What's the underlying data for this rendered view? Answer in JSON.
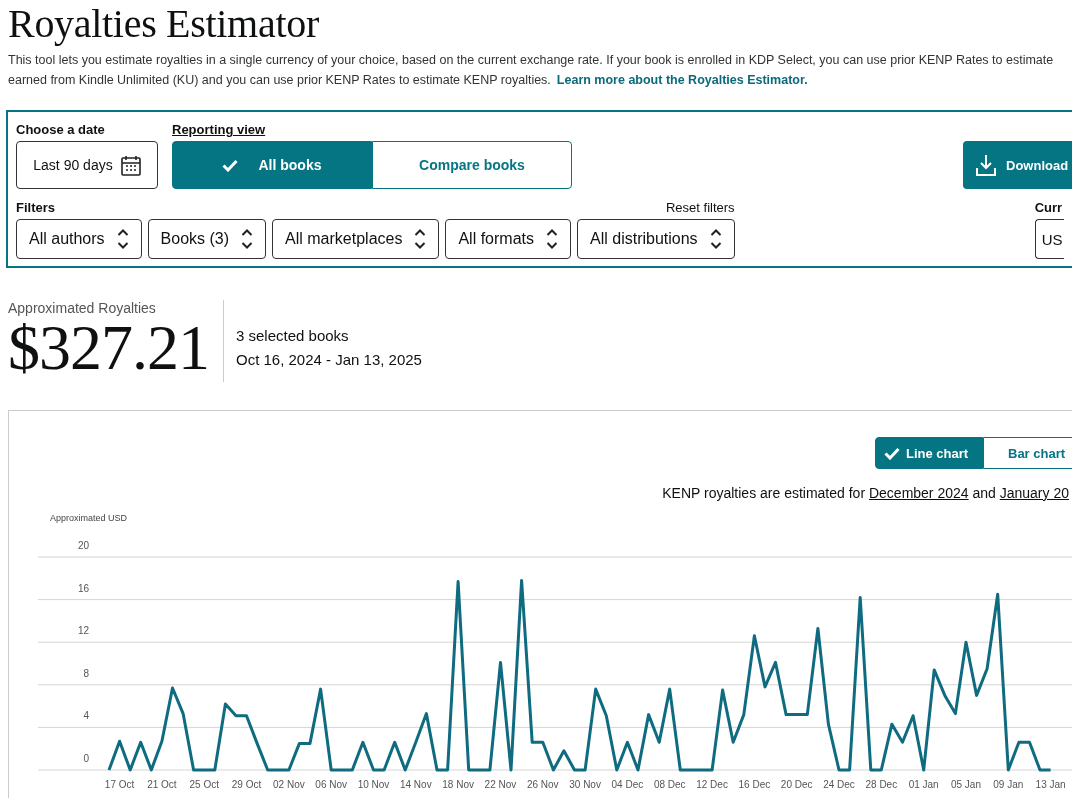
{
  "title": "Royalties Estimator",
  "description": {
    "line_1": "This tool lets you estimate royalties in a single currency of your choice, based on the current exchange rate. If your book is enrolled in KDP Select, you can use prior KENP Rates to estimate",
    "line_2": "earned from Kindle Unlimited (KU) and you can use prior KENP Rates to estimate KENP royalties.",
    "link": "Learn more about the Royalties Estimator."
  },
  "date_picker": {
    "label": "Choose a date",
    "value": "Last 90 days"
  },
  "reporting_view": {
    "label": "Reporting view",
    "options": [
      {
        "label": "All books",
        "selected": true
      },
      {
        "label": "Compare books",
        "selected": false
      }
    ]
  },
  "download_button": "Download",
  "filters": {
    "label": "Filters",
    "reset_label": "Reset filters",
    "dropdowns": [
      "All authors",
      "Books (3)",
      "All marketplaces",
      "All formats",
      "All distributions"
    ]
  },
  "currency": {
    "label": "Curr",
    "value": "US"
  },
  "summary": {
    "label": "Approximated Royalties",
    "amount": "$327.21",
    "books": "3 selected books",
    "date_range": "Oct 16, 2024 - Jan 13, 2025"
  },
  "chart_toggle": [
    {
      "label": "Line chart",
      "selected": true
    },
    {
      "label": "Bar chart",
      "selected": false
    }
  ],
  "kenp_note": {
    "prefix": "KENP royalties are estimated for",
    "link_1": "December 2024",
    "middle": "and",
    "link_2": "January 20"
  },
  "chart_data": {
    "type": "line",
    "ylabel": "Approximated USD",
    "ylim": [
      0,
      20
    ],
    "yticks": [
      0,
      4,
      8,
      12,
      16,
      20
    ],
    "grid": true,
    "categories": [
      null,
      "17 Oct",
      null,
      null,
      null,
      "21 Oct",
      null,
      null,
      null,
      "25 Oct",
      null,
      null,
      null,
      "29 Oct",
      null,
      null,
      null,
      "02 Nov",
      null,
      null,
      null,
      "06 Nov",
      null,
      null,
      null,
      "10 Nov",
      null,
      null,
      null,
      "14 Nov",
      null,
      null,
      null,
      "18 Nov",
      null,
      null,
      null,
      "22 Nov",
      null,
      null,
      null,
      "26 Nov",
      null,
      null,
      null,
      "30 Nov",
      null,
      null,
      null,
      "04 Dec",
      null,
      null,
      null,
      "08 Dec",
      null,
      null,
      null,
      "12 Dec",
      null,
      null,
      null,
      "16 Dec",
      null,
      null,
      null,
      "20 Dec",
      null,
      null,
      null,
      "24 Dec",
      null,
      null,
      null,
      "28 Dec",
      null,
      null,
      null,
      "01 Jan",
      null,
      null,
      null,
      "05 Jan",
      null,
      null,
      null,
      "09 Jan",
      null,
      null,
      null,
      "13 Jan"
    ],
    "series": [
      {
        "color": "#0f6b80",
        "values": [
          0,
          2.7,
          0,
          2.6,
          0,
          2.7,
          7.7,
          5.3,
          0,
          0,
          0,
          6.2,
          5.1,
          5.1,
          2.5,
          0,
          0,
          0,
          2.5,
          2.5,
          7.6,
          0,
          0,
          0,
          2.6,
          0,
          0,
          2.6,
          0,
          2.6,
          5.3,
          0,
          0,
          17.7,
          0,
          0,
          0,
          10.1,
          0,
          17.8,
          2.6,
          2.6,
          0,
          1.8,
          0,
          0,
          7.6,
          5.1,
          0,
          2.6,
          0,
          5.2,
          2.6,
          7.6,
          0,
          0,
          0,
          0,
          7.5,
          2.6,
          5.2,
          12.6,
          7.8,
          10.1,
          5.2,
          5.2,
          5.2,
          13.3,
          4.3,
          0,
          0,
          16.2,
          0,
          0,
          4.3,
          2.6,
          5.1,
          0,
          9.4,
          7.0,
          5.3,
          12.0,
          7.0,
          9.5,
          16.5,
          0,
          2.6,
          2.6,
          0,
          0
        ]
      }
    ]
  }
}
